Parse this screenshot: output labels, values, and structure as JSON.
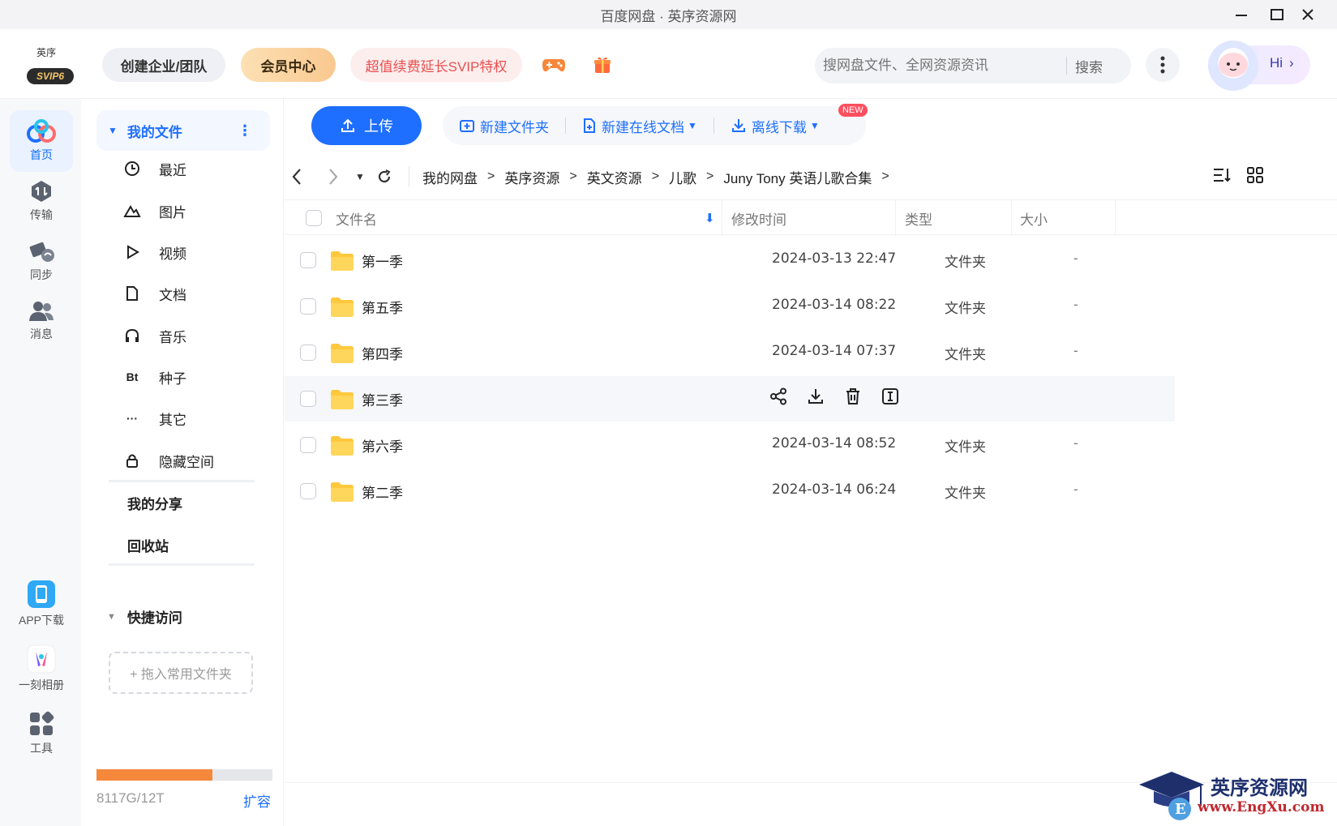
{
  "window": {
    "title": "百度网盘 · 英序资源网"
  },
  "header": {
    "logo_seal": "英序",
    "logo_badge": "SVIP6",
    "team_button": "创建企业/团队",
    "vip_button": "会员中心",
    "svip_promo": "超值续费延长SVIP特权",
    "search_placeholder": "搜网盘文件、全网资源资讯",
    "search_button": "搜索",
    "hi_label": "Hi"
  },
  "rail": {
    "items": [
      {
        "label": "首页",
        "icon": "home-icon"
      },
      {
        "label": "传输",
        "icon": "transfer-icon"
      },
      {
        "label": "同步",
        "icon": "sync-icon"
      },
      {
        "label": "消息",
        "icon": "message-icon"
      }
    ],
    "bottom": [
      {
        "label": "APP下载",
        "icon": "phone-icon"
      },
      {
        "label": "一刻相册",
        "icon": "album-icon"
      },
      {
        "label": "工具",
        "icon": "tools-icon"
      }
    ]
  },
  "sidebar": {
    "my_files": "我的文件",
    "items": [
      {
        "label": "最近",
        "icon": "clock-icon"
      },
      {
        "label": "图片",
        "icon": "image-icon"
      },
      {
        "label": "视频",
        "icon": "video-icon"
      },
      {
        "label": "文档",
        "icon": "document-icon"
      },
      {
        "label": "音乐",
        "icon": "headphones-icon"
      },
      {
        "label": "种子",
        "icon": "bt-icon"
      },
      {
        "label": "其它",
        "icon": "more-icon"
      },
      {
        "label": "隐藏空间",
        "icon": "lock-icon"
      }
    ],
    "my_share": "我的分享",
    "recycle": "回收站",
    "quick_access": "快捷访问",
    "dropzone": "+ 拖入常用文件夹",
    "quota_text": "8117G/12T",
    "quota_fraction": 0.661,
    "expand": "扩容"
  },
  "toolbar": {
    "upload": "上传",
    "new_folder": "新建文件夹",
    "new_doc": "新建在线文档",
    "new_badge": "NEW",
    "offline_download": "离线下载"
  },
  "breadcrumb": [
    "我的网盘",
    "英序资源",
    "英文资源",
    "儿歌",
    "Juny Tony 英语儿歌合集"
  ],
  "table": {
    "columns": {
      "name": "文件名",
      "modified": "修改时间",
      "type": "类型",
      "size": "大小"
    },
    "rows": [
      {
        "name": "第一季",
        "modified": "2024-03-13 22:47",
        "type": "文件夹",
        "size": "-"
      },
      {
        "name": "第五季",
        "modified": "2024-03-14 08:22",
        "type": "文件夹",
        "size": "-"
      },
      {
        "name": "第四季",
        "modified": "2024-03-14 07:37",
        "type": "文件夹",
        "size": "-"
      },
      {
        "name": "第三季",
        "modified": "",
        "type": "",
        "size": ""
      },
      {
        "name": "第六季",
        "modified": "2024-03-14 08:52",
        "type": "文件夹",
        "size": "-"
      },
      {
        "name": "第二季",
        "modified": "2024-03-14 06:24",
        "type": "文件夹",
        "size": "-"
      }
    ]
  },
  "watermark": {
    "line1": "英序资源网",
    "line2": "www.EngXu.com"
  },
  "colors": {
    "accent": "#1e6fff",
    "quota": "#f5883b",
    "promo": "#e8504f",
    "folder": "#ffc83d"
  }
}
